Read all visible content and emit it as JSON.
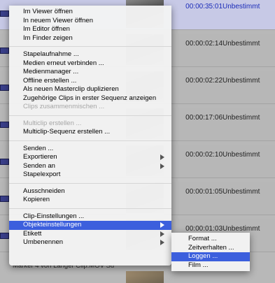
{
  "background_rows": [
    {
      "timecode": "00:00:35:01",
      "status": "Unbestimmt",
      "selected": true
    },
    {
      "timecode": "00:00:02:14",
      "status": "Unbestimmt",
      "selected": false
    },
    {
      "timecode": "00:00:02:22",
      "status": "Unbestimmt",
      "selected": false
    },
    {
      "timecode": "00:00:17:06",
      "status": "Unbestimmt",
      "selected": false
    },
    {
      "timecode": "00:00:02:10",
      "status": "Unbestimmt",
      "selected": false
    },
    {
      "timecode": "00:00:01:05",
      "status": "Unbestimmt",
      "selected": false
    },
    {
      "timecode": "00:00:01:03",
      "status": "Unbestimmt",
      "selected": false
    }
  ],
  "bottom_clip_label": "Marker 4  von Langer Clip.MOV Su",
  "context_menu": {
    "groups": [
      [
        {
          "label": "Im Viewer öffnen"
        },
        {
          "label": "In neuem Viewer öffnen"
        },
        {
          "label": "Im Editor öffnen"
        },
        {
          "label": "Im Finder zeigen"
        }
      ],
      [
        {
          "label": "Stapelaufnahme ..."
        },
        {
          "label": "Medien erneut verbinden ..."
        },
        {
          "label": "Medienmanager ..."
        },
        {
          "label": "Offline erstellen ..."
        },
        {
          "label": "Als neuen Masterclip duplizieren"
        },
        {
          "label": "Zugehörige Clips in erster Sequenz anzeigen"
        },
        {
          "label": "Clips zusammenmischen ...",
          "disabled": true
        }
      ],
      [
        {
          "label": "Multiclip erstellen ...",
          "disabled": true
        },
        {
          "label": "Multiclip-Sequenz erstellen ..."
        }
      ],
      [
        {
          "label": "Senden ..."
        },
        {
          "label": "Exportieren",
          "submenu": true
        },
        {
          "label": "Senden an",
          "submenu": true
        },
        {
          "label": "Stapelexport"
        }
      ],
      [
        {
          "label": "Ausschneiden"
        },
        {
          "label": "Kopieren"
        }
      ],
      [
        {
          "label": "Clip-Einstellungen ..."
        },
        {
          "label": "Objekteinstellungen",
          "submenu": true,
          "highlighted": true
        },
        {
          "label": "Etikett",
          "submenu": true
        },
        {
          "label": "Umbenennen",
          "submenu": true
        }
      ]
    ]
  },
  "submenu": {
    "items": [
      {
        "label": "Format ..."
      },
      {
        "label": "Zeitverhalten ..."
      },
      {
        "label": "Loggen ...",
        "highlighted": true
      },
      {
        "label": "Film ..."
      }
    ]
  },
  "colors": {
    "highlight": "#3c5fdd",
    "selected_row_text": "#1a2bb8",
    "disabled_text": "#a6a6a6"
  }
}
